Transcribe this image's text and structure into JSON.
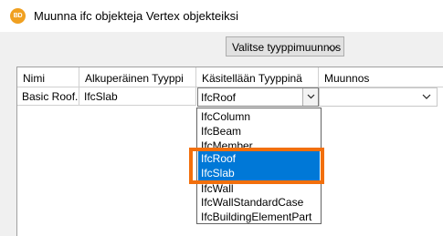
{
  "window": {
    "app_icon_text": "BD",
    "title": "Muunna ifc objekteja Vertex objekteiksi"
  },
  "toolbar": {
    "dropdown_label": "Valitse tyyppimuunnos"
  },
  "table": {
    "columns": [
      "Nimi",
      "Alkuperäinen Tyyppi",
      "Käsitellään Tyyppinä",
      "Muunnos"
    ],
    "rows": [
      {
        "name": "Basic Roof...",
        "original_type": "IfcSlab",
        "handled_as": "IfcRoof",
        "conversion": ""
      }
    ]
  },
  "dropdown_list": {
    "items": [
      "IfcColumn",
      "IfcBeam",
      "IfcMember",
      "IfcRoof",
      "IfcSlab",
      "IfcWall",
      "IfcWallStandardCase",
      "IfcBuildingElementPart"
    ],
    "selected": [
      "IfcRoof",
      "IfcSlab"
    ]
  },
  "colors": {
    "selection": "#0078d7",
    "annotation": "#f26f0c"
  }
}
